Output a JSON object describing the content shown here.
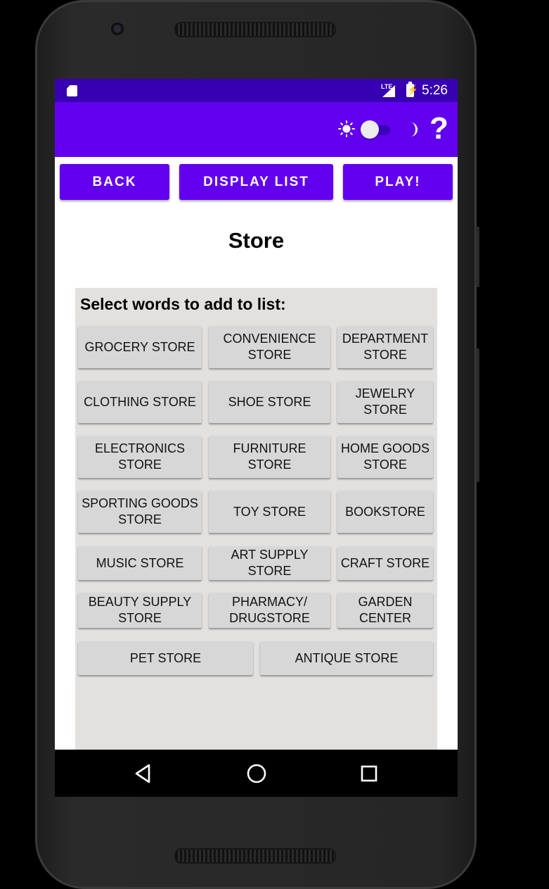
{
  "status_bar": {
    "network_label": "LTE",
    "time": "5:26",
    "battery_glyph": "⚡"
  },
  "app_bar": {
    "help_label": "?"
  },
  "toolbar": {
    "back_label": "BACK",
    "display_list_label": "DISPLAY LIST",
    "play_label": "PLAY!"
  },
  "page": {
    "title": "Store"
  },
  "word_panel": {
    "heading": "Select words to add to list:",
    "words": [
      "GROCERY STORE",
      "CONVENIENCE\nSTORE",
      "DEPARTMENT\nSTORE",
      "CLOTHING STORE",
      "SHOE STORE",
      "JEWELRY\nSTORE",
      "ELECTRONICS\nSTORE",
      "FURNITURE STORE",
      "HOME GOODS\nSTORE",
      "SPORTING GOODS\nSTORE",
      "TOY STORE",
      "BOOKSTORE",
      "MUSIC STORE",
      "ART SUPPLY STORE",
      "CRAFT STORE",
      "BEAUTY SUPPLY\nSTORE",
      "PHARMACY/\nDRUGSTORE",
      "GARDEN\nCENTER",
      "PET STORE",
      "ANTIQUE STORE"
    ]
  },
  "theme": {
    "status_bar_color": "#3700b3",
    "primary_color": "#6200ee",
    "panel_color": "#e2e1df",
    "word_button_color": "#d7d7d7"
  },
  "icons": {
    "sd_card": "sd-card-icon",
    "signal": "signal-icon",
    "battery": "battery-charging-icon",
    "light_mode": "sun-icon",
    "dark_mode": "moon-icon",
    "help": "help-icon",
    "nav_back": "nav-back-icon",
    "nav_home": "nav-home-icon",
    "nav_recents": "nav-recents-icon"
  },
  "theme_toggle": {
    "dark_mode_on": false
  }
}
